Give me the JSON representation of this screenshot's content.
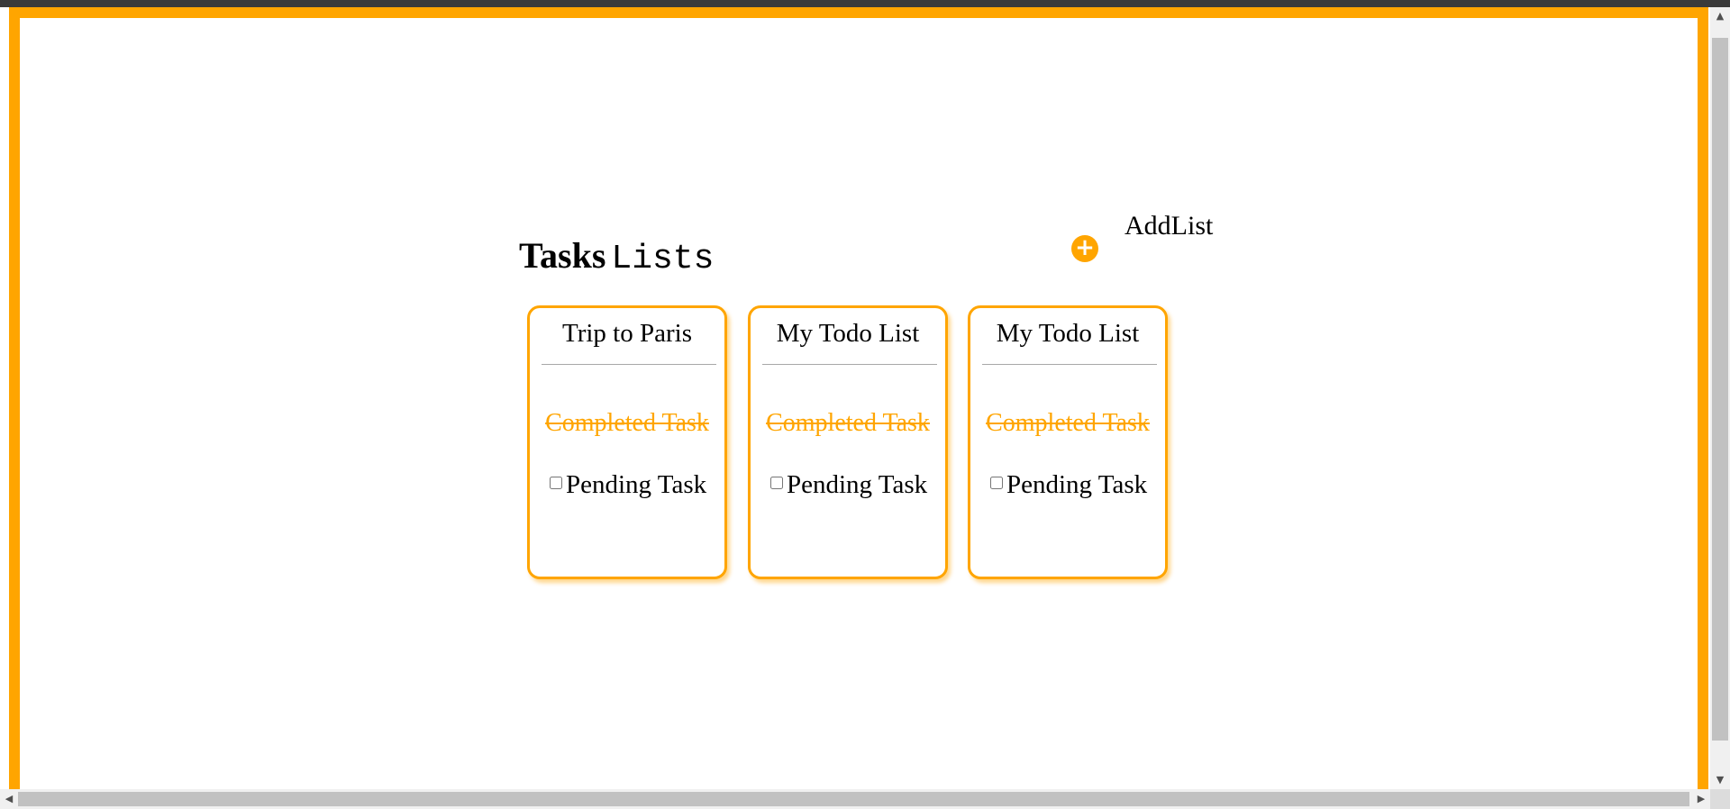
{
  "header": {
    "title_bold": "Tasks",
    "title_mono": "Lists"
  },
  "add_list": {
    "icon": "plus-circle-icon",
    "symbol": "+",
    "label": "AddList"
  },
  "colors": {
    "accent": "#FFA500",
    "title_bar": "#3a3a3a"
  },
  "lists": [
    {
      "title": "Trip to Paris",
      "completed_task": "Completed Task",
      "pending_task": "Pending Task",
      "pending_checked": false
    },
    {
      "title": "My Todo List",
      "completed_task": "Completed Task",
      "pending_task": "Pending Task",
      "pending_checked": false
    },
    {
      "title": "My Todo List",
      "completed_task": "Completed Task",
      "pending_task": "Pending Task",
      "pending_checked": false
    }
  ]
}
